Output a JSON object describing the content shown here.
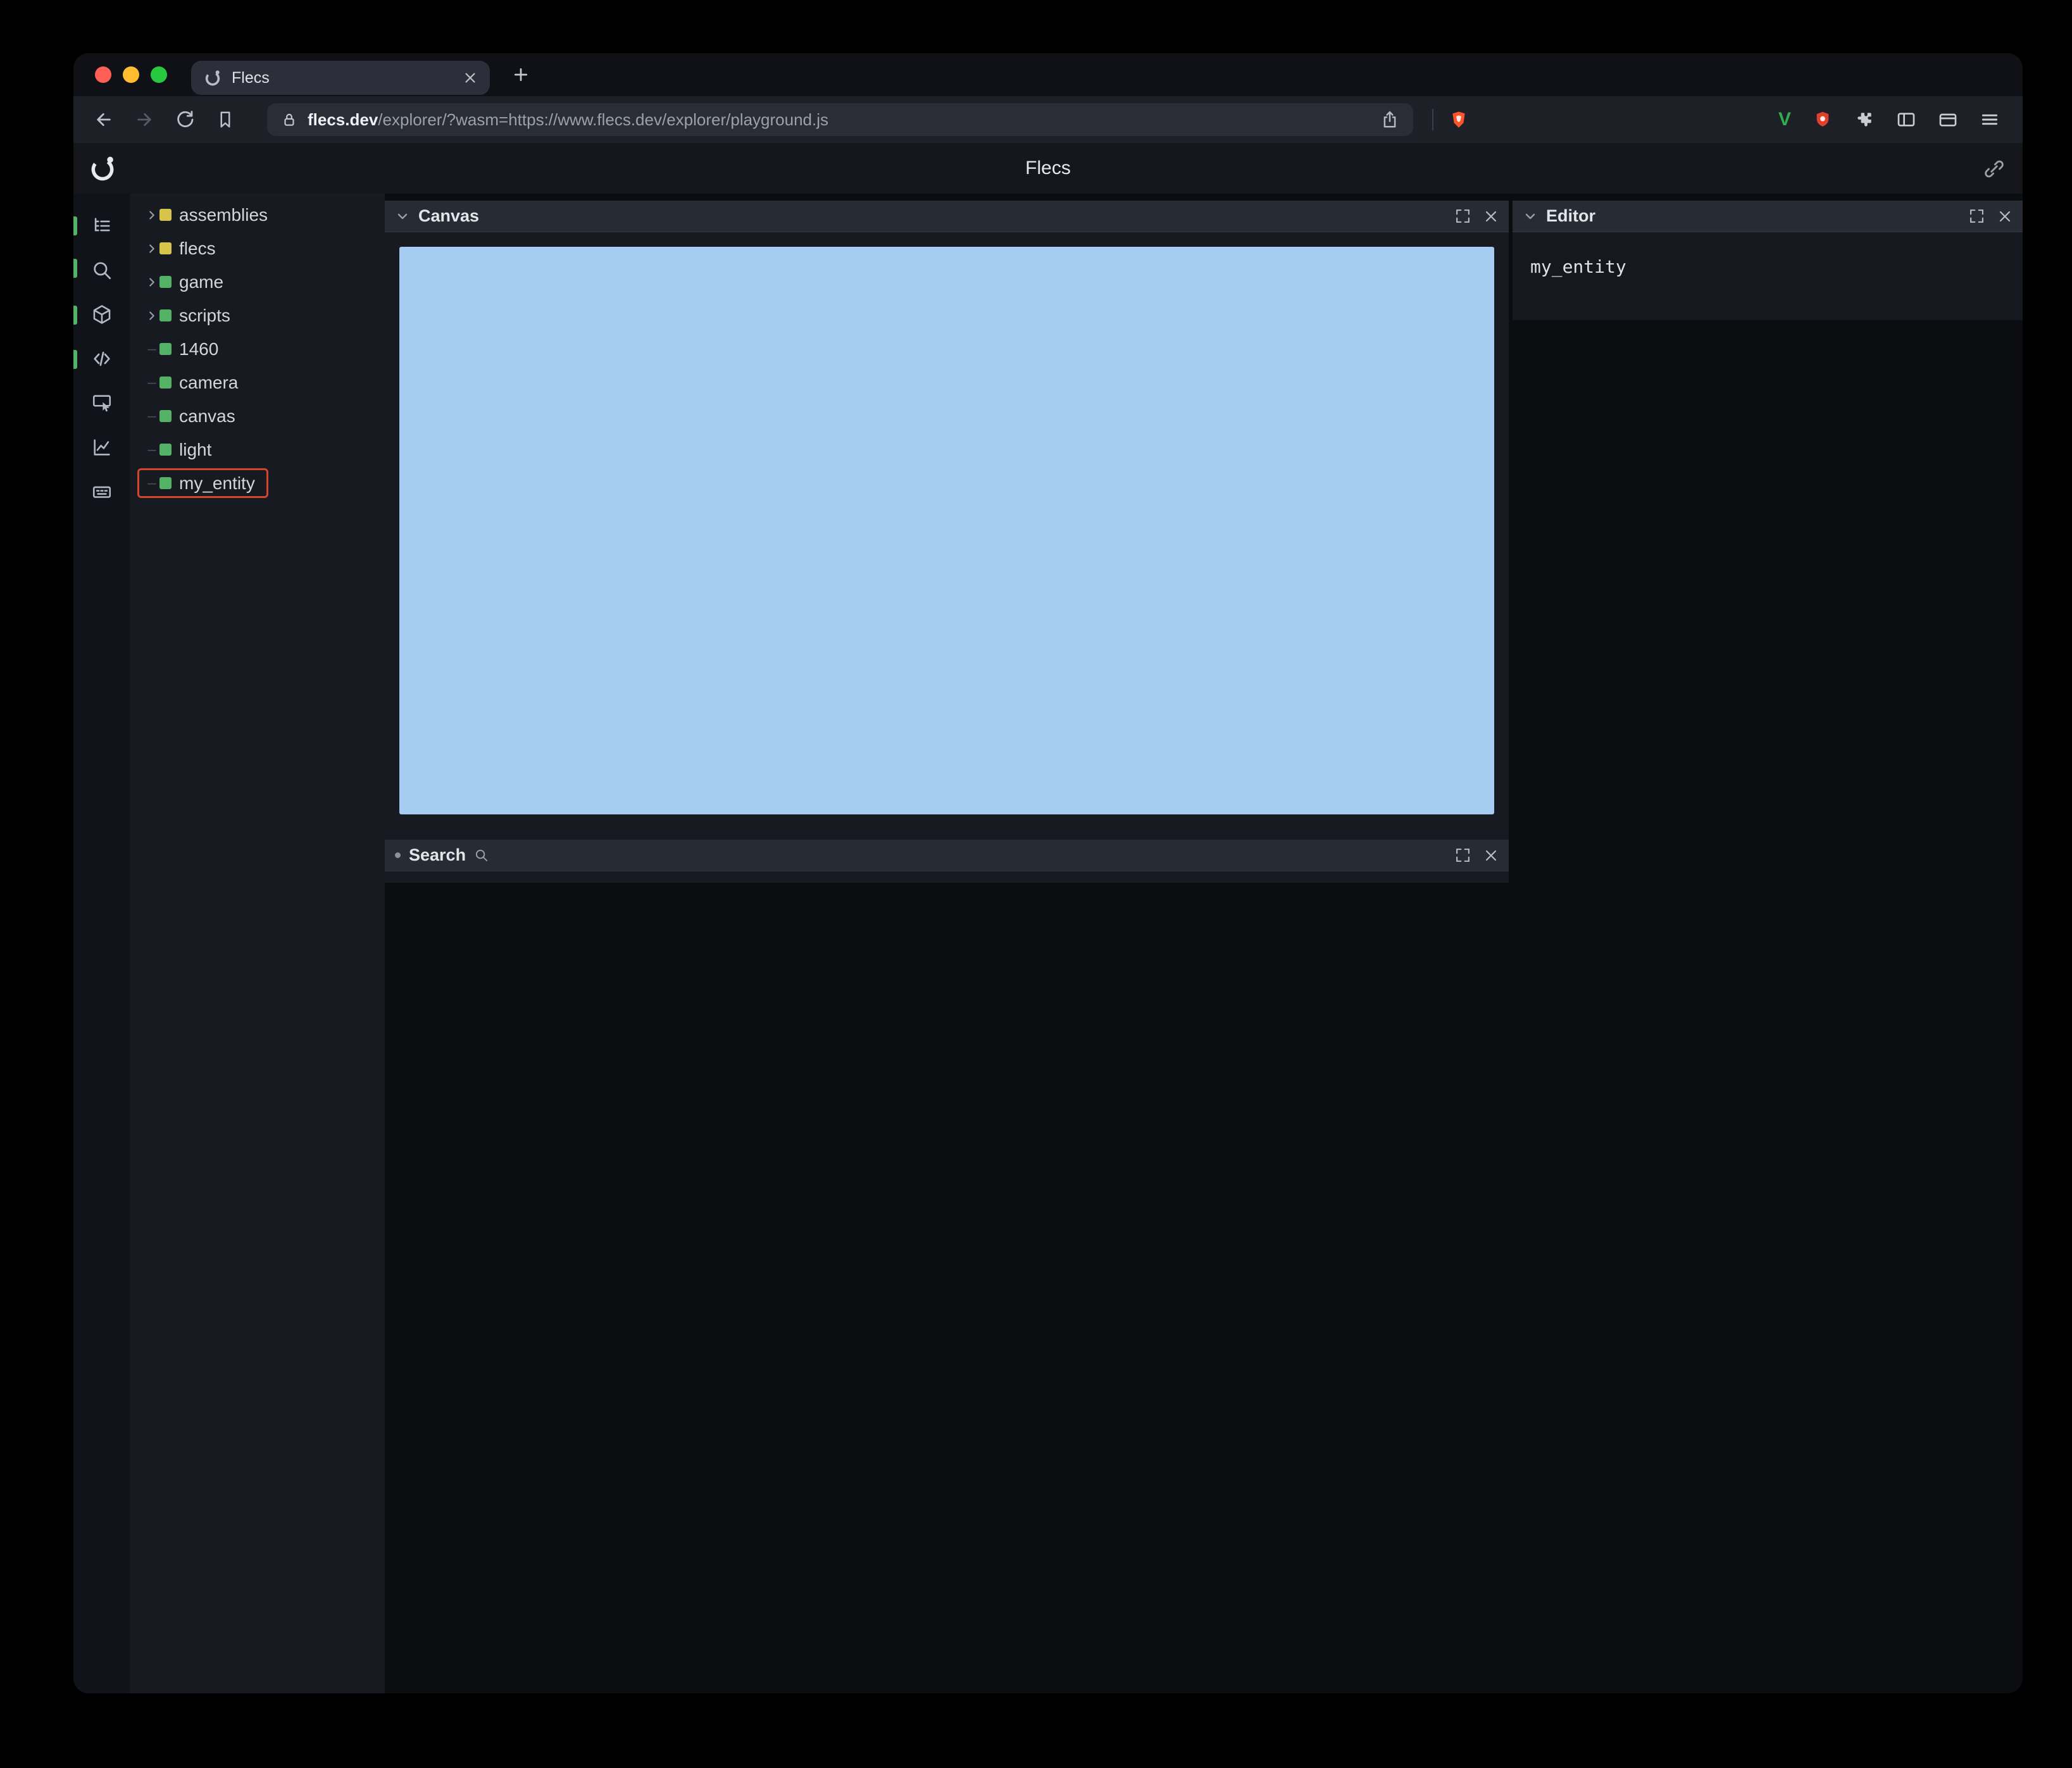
{
  "browser": {
    "tab": {
      "title": "Flecs"
    },
    "newtab_label": "+",
    "url": {
      "domain": "flecs.dev",
      "rest": "/explorer/?wasm=https://www.flecs.dev/explorer/playground.js"
    },
    "ext_v_label": "V"
  },
  "app": {
    "header": {
      "title": "Flecs"
    },
    "tree": {
      "items": [
        {
          "label": "assemblies",
          "color": "yellow",
          "expandable": true
        },
        {
          "label": "flecs",
          "color": "yellow",
          "expandable": true
        },
        {
          "label": "game",
          "color": "green",
          "expandable": true
        },
        {
          "label": "scripts",
          "color": "green",
          "expandable": true
        },
        {
          "label": "1460",
          "color": "green",
          "expandable": false
        },
        {
          "label": "camera",
          "color": "green",
          "expandable": false
        },
        {
          "label": "canvas",
          "color": "green",
          "expandable": false
        },
        {
          "label": "light",
          "color": "green",
          "expandable": false
        },
        {
          "label": "my_entity",
          "color": "green",
          "expandable": false,
          "selected": true
        }
      ]
    },
    "panels": {
      "canvas": {
        "title": "Canvas"
      },
      "search": {
        "title": "Search"
      },
      "editor": {
        "title": "Editor",
        "content": "my_entity"
      }
    },
    "icons": {
      "rail": [
        "tree-icon",
        "search-icon",
        "entities-cube-icon",
        "code-icon",
        "inspector-icon",
        "stats-chart-icon",
        "commands-icon"
      ]
    },
    "colors": {
      "canvas_fill": "#a6cdf1",
      "selection": "#d2452c",
      "accent_green": "#54b266",
      "accent_yellow": "#d8c44a"
    }
  }
}
